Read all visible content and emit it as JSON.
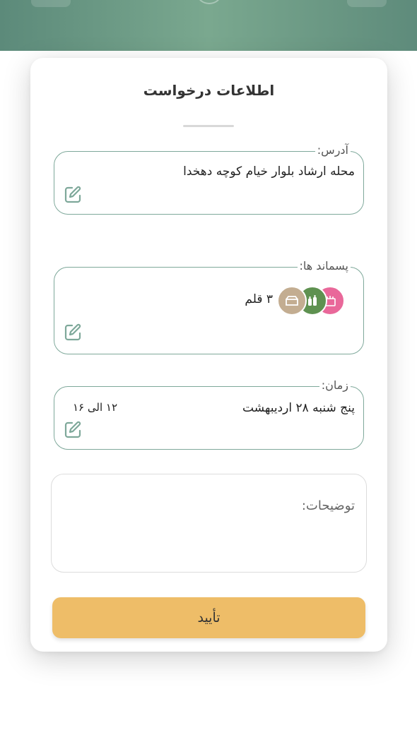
{
  "colors": {
    "header_bg": "#6b9886",
    "field_border": "#7ea89a",
    "confirm_bg": "#eebd68",
    "waste_pink": "#e9689a",
    "waste_green": "#5e9150",
    "waste_beige": "#c3ad91"
  },
  "card": {
    "title": "اطلاعات درخواست"
  },
  "address": {
    "label": "آدرس:",
    "value": "محله ارشاد  بلوار خیام کوچه دهخدا",
    "edit_icon": "pencil-edit-icon"
  },
  "waste": {
    "label": "پسماند ها:",
    "count_text": "۳ قلم",
    "items": [
      "recycle-pink-icon",
      "bottles-green-icon",
      "box-beige-icon"
    ],
    "edit_icon": "pencil-edit-icon"
  },
  "time": {
    "label": "زمان:",
    "date": "پنج شنبه ۲۸ اردیبهشت",
    "range": "۱۲ الی ۱۶",
    "edit_icon": "pencil-edit-icon"
  },
  "notes": {
    "placeholder": "توضیحات:"
  },
  "confirm": {
    "label": "تأیید"
  }
}
